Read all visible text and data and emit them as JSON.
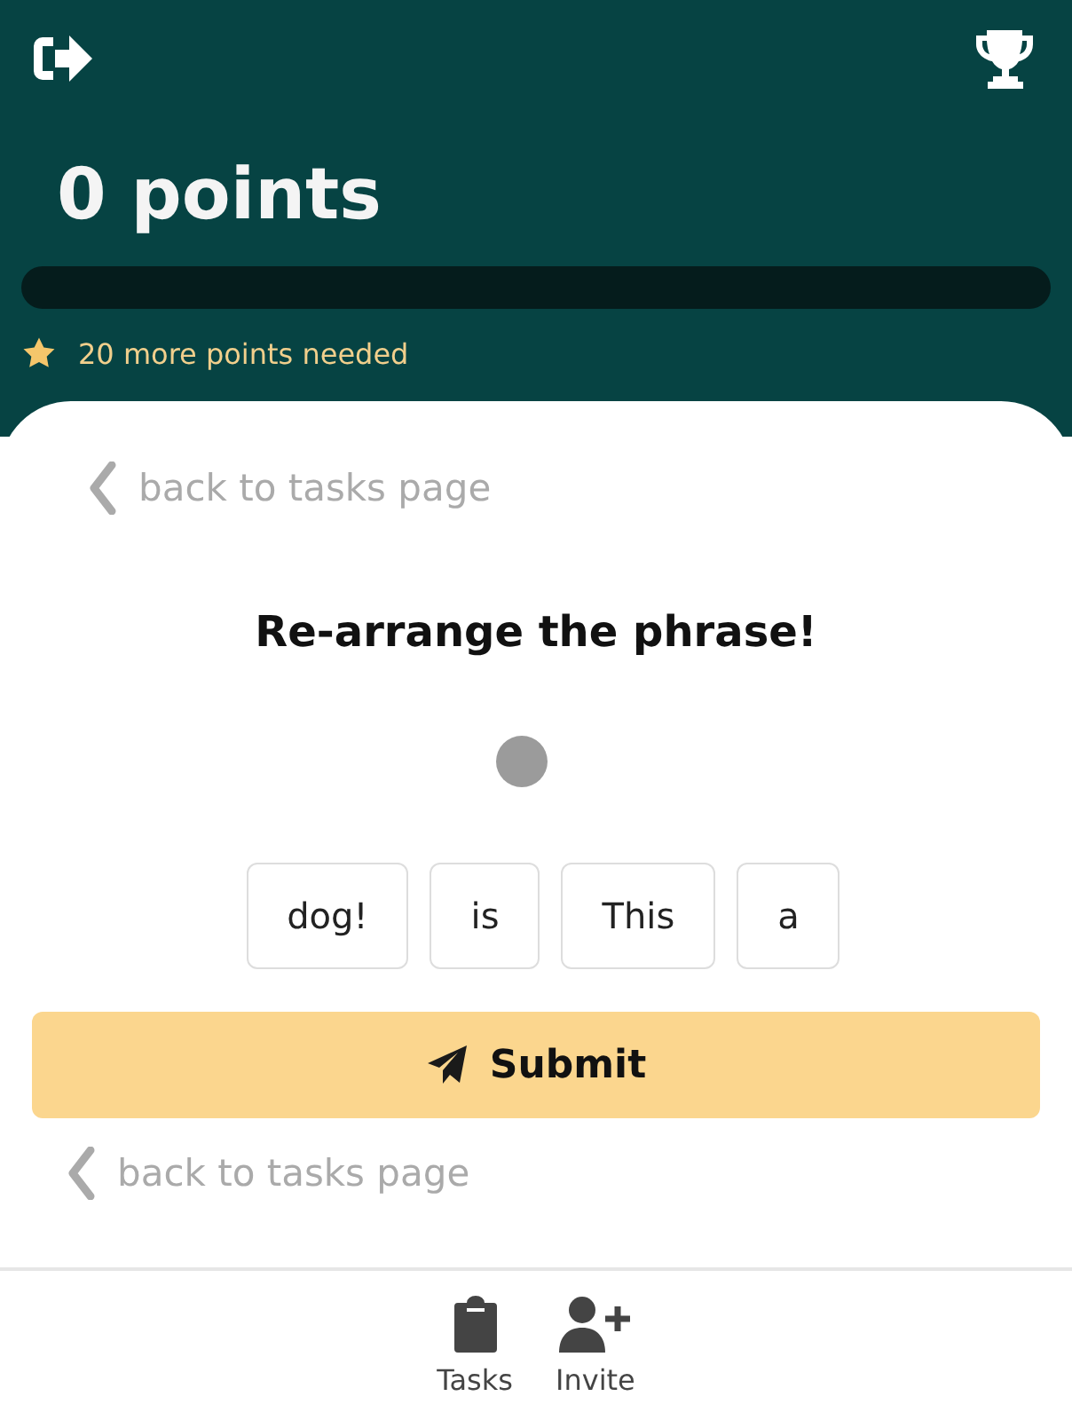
{
  "header": {
    "points": "0 points",
    "progress": {
      "level": 0
    },
    "goal": "20 more points needed"
  },
  "task": {
    "back_top": "back to tasks page",
    "title": "Re-arrange the phrase!",
    "words": [
      {
        "label": "dog!"
      },
      {
        "label": "is"
      },
      {
        "label": "This"
      },
      {
        "label": "a"
      }
    ],
    "submit": "Submit",
    "back_bottom": "back to tasks page"
  },
  "nav": [
    {
      "kind": "tasks",
      "label": "Tasks"
    },
    {
      "kind": "invite",
      "label": "Invite"
    }
  ]
}
